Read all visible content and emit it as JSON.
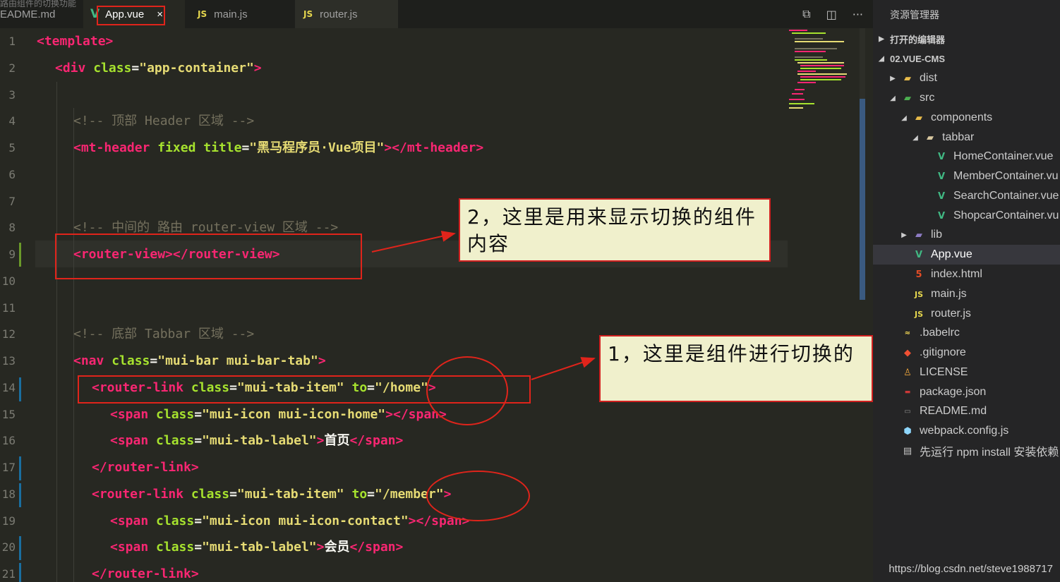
{
  "tabs": {
    "crumb": "路由组件的切换功能",
    "readme": "EADME.md",
    "app": "App.vue",
    "main": "main.js",
    "router": "router.js",
    "js_badge": "JS",
    "close": "×"
  },
  "editor": {
    "line_numbers": [
      "1",
      "2",
      "3",
      "4",
      "5",
      "6",
      "7",
      "8",
      "9",
      "10",
      "11",
      "12",
      "13",
      "14",
      "15",
      "16",
      "17",
      "18",
      "19",
      "20",
      "21"
    ],
    "code": {
      "l1_tag": "<template>",
      "l2_tag": "<div",
      "l2_attr": "class",
      "l2_str": "\"app-container\"",
      "l2_end": ">",
      "l4_cmt": "<!-- 顶部 Header 区域 -->",
      "l5_tag": "<mt-header",
      "l5_attr1": "fixed",
      "l5_attr2": "title",
      "l5_str": "\"黑马程序员·Vue项目\"",
      "l5_end": "></mt-header>",
      "l8_cmt": "<!-- 中间的 路由 router-view 区域 -->",
      "l9_open": "<router-view>",
      "l9_close": "</router-view>",
      "l12_cmt": "<!-- 底部 Tabbar 区域 -->",
      "l13_tag": "<nav",
      "l13_attr": "class",
      "l13_str": "\"mui-bar mui-bar-tab\"",
      "l13_end": ">",
      "l14_tag": "<router-link",
      "l14_attr1": "class",
      "l14_str1": "\"mui-tab-item\"",
      "l14_attr2": "to",
      "l14_str2": "\"/home\"",
      "l14_end": ">",
      "l15_tag": "<span",
      "l15_attr": "class",
      "l15_str": "\"mui-icon mui-icon-home\"",
      "l15_end": "></span>",
      "l16_tag": "<span",
      "l16_attr": "class",
      "l16_str": "\"mui-tab-label\"",
      "l16_text": "首页",
      "l16_end": "</span>",
      "l17_tag": "</router-link>",
      "l18_tag": "<router-link",
      "l18_attr1": "class",
      "l18_str1": "\"mui-tab-item\"",
      "l18_attr2": "to",
      "l18_str2": "\"/member\"",
      "l18_end": ">",
      "l19_tag": "<span",
      "l19_attr": "class",
      "l19_str": "\"mui-icon mui-icon-contact\"",
      "l19_end": "></span>",
      "l20_tag": "<span",
      "l20_attr": "class",
      "l20_str": "\"mui-tab-label\"",
      "l20_text": "会员",
      "l20_end": "</span>",
      "l21_tag": "</router-link>"
    }
  },
  "annotations": {
    "callout_2": "2，这里是用来显示切换的组件内容",
    "callout_1": "1，这里是组件进行切换的"
  },
  "explorer": {
    "title": "资源管理器",
    "open_editors": "打开的编辑器",
    "project": "02.VUE-CMS",
    "items": {
      "dist": "dist",
      "src": "src",
      "components": "components",
      "tabbar": "tabbar",
      "home": "HomeContainer.vue",
      "member": "MemberContainer.vu",
      "search": "SearchContainer.vue",
      "shopcar": "ShopcarContainer.vu",
      "lib": "lib",
      "app": "App.vue",
      "index": "index.html",
      "main": "main.js",
      "router": "router.js",
      "babelrc": ".babelrc",
      "gitignore": ".gitignore",
      "license": "LICENSE",
      "package": "package.json",
      "readme": "README.md",
      "webpack": "webpack.config.js",
      "note": "先运行 npm install 安装依赖"
    }
  },
  "watermark": "https://blog.csdn.net/steve1988717",
  "colors": {
    "tag": "#f92672",
    "attr": "#a6e22e",
    "string": "#e6db74",
    "comment": "#75715e",
    "annotation_red": "#e0241b",
    "callout_bg": "#f0f0cc"
  }
}
